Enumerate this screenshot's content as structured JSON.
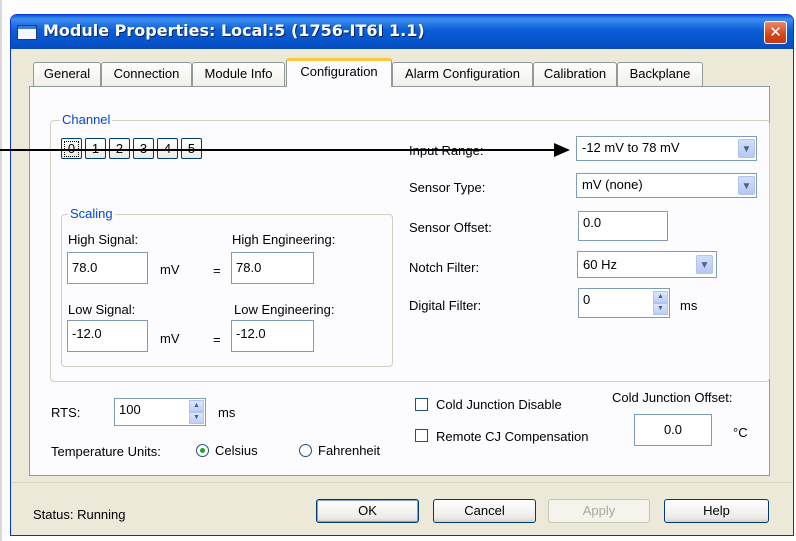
{
  "window": {
    "title": "Module Properties: Local:5 (1756-IT6I 1.1)",
    "close_glyph": "✕"
  },
  "tabs": [
    {
      "label": "General"
    },
    {
      "label": "Connection"
    },
    {
      "label": "Module Info"
    },
    {
      "label": "Configuration",
      "active": true
    },
    {
      "label": "Alarm Configuration"
    },
    {
      "label": "Calibration"
    },
    {
      "label": "Backplane"
    }
  ],
  "channel": {
    "group_label": "Channel",
    "buttons": [
      "0",
      "1",
      "2",
      "3",
      "4",
      "5"
    ],
    "selected": "0"
  },
  "scaling": {
    "group_label": "Scaling",
    "high_signal_label": "High Signal:",
    "high_signal_value": "78.0",
    "high_signal_unit": "mV",
    "high_eng_label": "High Engineering:",
    "high_eng_value": "78.0",
    "low_signal_label": "Low Signal:",
    "low_signal_value": "-12.0",
    "low_signal_unit": "mV",
    "low_eng_label": "Low Engineering:",
    "low_eng_value": "-12.0",
    "equals": "="
  },
  "settings": {
    "input_range_label": "Input Range:",
    "input_range_value": "-12 mV to 78 mV",
    "sensor_type_label": "Sensor Type:",
    "sensor_type_value": "mV (none)",
    "sensor_offset_label": "Sensor Offset:",
    "sensor_offset_value": "0.0",
    "notch_filter_label": "Notch Filter:",
    "notch_filter_value": "60 Hz",
    "digital_filter_label": "Digital Filter:",
    "digital_filter_value": "0",
    "digital_filter_unit": "ms"
  },
  "rts": {
    "label": "RTS:",
    "value": "100",
    "unit": "ms"
  },
  "temperature_units": {
    "label": "Temperature Units:",
    "options": [
      "Celsius",
      "Fahrenheit"
    ],
    "selected": "Celsius"
  },
  "cold_junction": {
    "disable_label": "Cold Junction Disable",
    "disable_checked": false,
    "remote_label": "Remote CJ Compensation",
    "remote_checked": false,
    "offset_label": "Cold Junction Offset:",
    "offset_value": "0.0",
    "offset_unit": "°C"
  },
  "footer": {
    "status": "Status:  Running",
    "ok": "OK",
    "cancel": "Cancel",
    "apply": "Apply",
    "help": "Help"
  },
  "icons": {
    "dropdown": "▼",
    "spin_up": "▲",
    "spin_down": "▼"
  },
  "colors": {
    "titlebar": "#0a5fd6",
    "close": "#d4451b",
    "active_tab_accent": "#ffc83c",
    "group_label": "#0046d5",
    "arrow": "#000000"
  }
}
